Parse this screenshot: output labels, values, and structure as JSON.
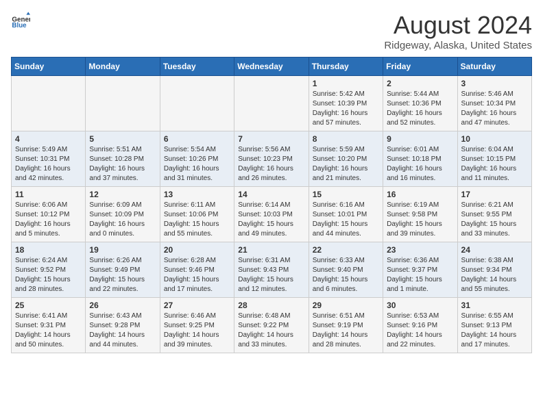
{
  "header": {
    "logo_general": "General",
    "logo_blue": "Blue",
    "main_title": "August 2024",
    "subtitle": "Ridgeway, Alaska, United States"
  },
  "days_of_week": [
    "Sunday",
    "Monday",
    "Tuesday",
    "Wednesday",
    "Thursday",
    "Friday",
    "Saturday"
  ],
  "weeks": [
    [
      {
        "day": "",
        "info": ""
      },
      {
        "day": "",
        "info": ""
      },
      {
        "day": "",
        "info": ""
      },
      {
        "day": "",
        "info": ""
      },
      {
        "day": "1",
        "info": "Sunrise: 5:42 AM\nSunset: 10:39 PM\nDaylight: 16 hours\nand 57 minutes."
      },
      {
        "day": "2",
        "info": "Sunrise: 5:44 AM\nSunset: 10:36 PM\nDaylight: 16 hours\nand 52 minutes."
      },
      {
        "day": "3",
        "info": "Sunrise: 5:46 AM\nSunset: 10:34 PM\nDaylight: 16 hours\nand 47 minutes."
      }
    ],
    [
      {
        "day": "4",
        "info": "Sunrise: 5:49 AM\nSunset: 10:31 PM\nDaylight: 16 hours\nand 42 minutes."
      },
      {
        "day": "5",
        "info": "Sunrise: 5:51 AM\nSunset: 10:28 PM\nDaylight: 16 hours\nand 37 minutes."
      },
      {
        "day": "6",
        "info": "Sunrise: 5:54 AM\nSunset: 10:26 PM\nDaylight: 16 hours\nand 31 minutes."
      },
      {
        "day": "7",
        "info": "Sunrise: 5:56 AM\nSunset: 10:23 PM\nDaylight: 16 hours\nand 26 minutes."
      },
      {
        "day": "8",
        "info": "Sunrise: 5:59 AM\nSunset: 10:20 PM\nDaylight: 16 hours\nand 21 minutes."
      },
      {
        "day": "9",
        "info": "Sunrise: 6:01 AM\nSunset: 10:18 PM\nDaylight: 16 hours\nand 16 minutes."
      },
      {
        "day": "10",
        "info": "Sunrise: 6:04 AM\nSunset: 10:15 PM\nDaylight: 16 hours\nand 11 minutes."
      }
    ],
    [
      {
        "day": "11",
        "info": "Sunrise: 6:06 AM\nSunset: 10:12 PM\nDaylight: 16 hours\nand 5 minutes."
      },
      {
        "day": "12",
        "info": "Sunrise: 6:09 AM\nSunset: 10:09 PM\nDaylight: 16 hours\nand 0 minutes."
      },
      {
        "day": "13",
        "info": "Sunrise: 6:11 AM\nSunset: 10:06 PM\nDaylight: 15 hours\nand 55 minutes."
      },
      {
        "day": "14",
        "info": "Sunrise: 6:14 AM\nSunset: 10:03 PM\nDaylight: 15 hours\nand 49 minutes."
      },
      {
        "day": "15",
        "info": "Sunrise: 6:16 AM\nSunset: 10:01 PM\nDaylight: 15 hours\nand 44 minutes."
      },
      {
        "day": "16",
        "info": "Sunrise: 6:19 AM\nSunset: 9:58 PM\nDaylight: 15 hours\nand 39 minutes."
      },
      {
        "day": "17",
        "info": "Sunrise: 6:21 AM\nSunset: 9:55 PM\nDaylight: 15 hours\nand 33 minutes."
      }
    ],
    [
      {
        "day": "18",
        "info": "Sunrise: 6:24 AM\nSunset: 9:52 PM\nDaylight: 15 hours\nand 28 minutes."
      },
      {
        "day": "19",
        "info": "Sunrise: 6:26 AM\nSunset: 9:49 PM\nDaylight: 15 hours\nand 22 minutes."
      },
      {
        "day": "20",
        "info": "Sunrise: 6:28 AM\nSunset: 9:46 PM\nDaylight: 15 hours\nand 17 minutes."
      },
      {
        "day": "21",
        "info": "Sunrise: 6:31 AM\nSunset: 9:43 PM\nDaylight: 15 hours\nand 12 minutes."
      },
      {
        "day": "22",
        "info": "Sunrise: 6:33 AM\nSunset: 9:40 PM\nDaylight: 15 hours\nand 6 minutes."
      },
      {
        "day": "23",
        "info": "Sunrise: 6:36 AM\nSunset: 9:37 PM\nDaylight: 15 hours\nand 1 minute."
      },
      {
        "day": "24",
        "info": "Sunrise: 6:38 AM\nSunset: 9:34 PM\nDaylight: 14 hours\nand 55 minutes."
      }
    ],
    [
      {
        "day": "25",
        "info": "Sunrise: 6:41 AM\nSunset: 9:31 PM\nDaylight: 14 hours\nand 50 minutes."
      },
      {
        "day": "26",
        "info": "Sunrise: 6:43 AM\nSunset: 9:28 PM\nDaylight: 14 hours\nand 44 minutes."
      },
      {
        "day": "27",
        "info": "Sunrise: 6:46 AM\nSunset: 9:25 PM\nDaylight: 14 hours\nand 39 minutes."
      },
      {
        "day": "28",
        "info": "Sunrise: 6:48 AM\nSunset: 9:22 PM\nDaylight: 14 hours\nand 33 minutes."
      },
      {
        "day": "29",
        "info": "Sunrise: 6:51 AM\nSunset: 9:19 PM\nDaylight: 14 hours\nand 28 minutes."
      },
      {
        "day": "30",
        "info": "Sunrise: 6:53 AM\nSunset: 9:16 PM\nDaylight: 14 hours\nand 22 minutes."
      },
      {
        "day": "31",
        "info": "Sunrise: 6:55 AM\nSunset: 9:13 PM\nDaylight: 14 hours\nand 17 minutes."
      }
    ]
  ]
}
